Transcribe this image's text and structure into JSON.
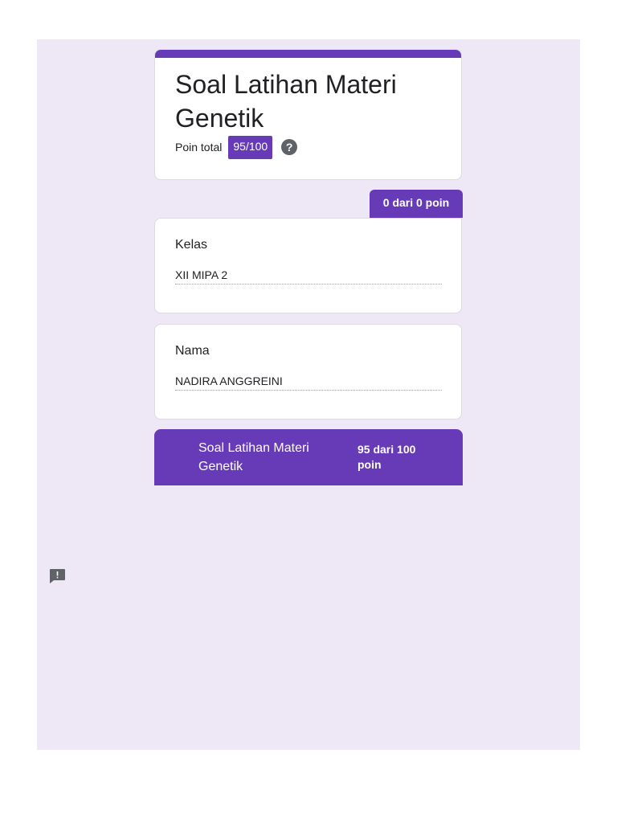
{
  "form": {
    "title": "Soal Latihan Materi Genetik",
    "points_label": "Poin total",
    "points_value": "95/100",
    "help_icon": "help-circle-icon"
  },
  "section": {
    "score_tab": "0 dari 0 poin"
  },
  "questions": [
    {
      "label": "Kelas",
      "answer": "XII MIPA 2"
    },
    {
      "label": "Nama",
      "answer": "NADIRA ANGGREINI"
    }
  ],
  "score_bar": {
    "title": "Soal Latihan Materi Genetik",
    "score": "95 dari 100 poin"
  },
  "feedback": {
    "icon": "report-feedback-icon"
  },
  "colors": {
    "accent": "#673ab7",
    "background": "#ede7f6"
  }
}
